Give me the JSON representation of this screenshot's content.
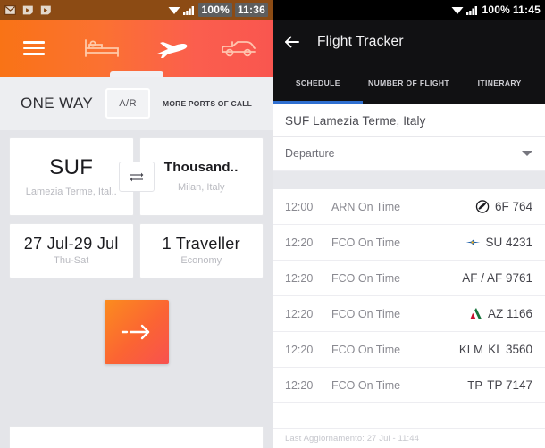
{
  "left_phone": {
    "status_bar": {
      "icons": [
        "gmail-icon",
        "video-badge-icon",
        "video-badge-icon"
      ],
      "battery": "100%",
      "time": "11:36",
      "wifi": "wifi-icon",
      "signal": "signal-icon"
    },
    "app_bar": {
      "menu": "hamburger-icon",
      "tabs": [
        {
          "icon": "hotel-bed-icon",
          "label": "Hotels",
          "active": false
        },
        {
          "icon": "airplane-icon",
          "label": "Flights",
          "active": true
        },
        {
          "icon": "car-icon",
          "label": "Cars",
          "active": false
        }
      ]
    },
    "segment_row": {
      "one_way": "ONE WAY",
      "round_trip": "A/R",
      "more_ports": "MORE PORTS OF CALL"
    },
    "search_form": {
      "origin": {
        "code": "SUF",
        "city": "Lamezia Terme, Ital.."
      },
      "swap": "swap-icon",
      "destination": {
        "code": "Thousand..",
        "city": "Milan, Italy"
      },
      "dates": {
        "range": "27 Jul-29 Jul",
        "days": "Thu-Sat"
      },
      "travellers": {
        "count": "1 Traveller",
        "cabin": "Economy"
      }
    },
    "search_button": {
      "icon": "arrow-right-icon",
      "label": "Search"
    }
  },
  "right_phone": {
    "status_bar": {
      "battery": "100%",
      "time": "11:45",
      "wifi": "wifi-icon",
      "signal": "signal-icon"
    },
    "app_bar": {
      "back": "back-arrow-icon",
      "title": "Flight Tracker"
    },
    "tabs": [
      {
        "label": "SCHEDULE",
        "active": true
      },
      {
        "label": "NUMBER OF FLIGHT",
        "active": false
      },
      {
        "label": "ITINERARY",
        "active": false
      }
    ],
    "filters": {
      "airport": "SUF Lamezia Terme, Italy",
      "direction_label": "Departure",
      "direction_caret": "chevron-down-icon"
    },
    "flights": [
      {
        "time": "12:00",
        "status": "ARN On Time",
        "logo": "6f-logo",
        "code": "6F 764"
      },
      {
        "time": "12:20",
        "status": "FCO On Time",
        "logo": "su-logo",
        "code": "SU 4231"
      },
      {
        "time": "12:20",
        "status": "FCO On Time",
        "logo": "af-logo-text",
        "code": "AF / AF 9761"
      },
      {
        "time": "12:20",
        "status": "FCO On Time",
        "logo": "az-logo",
        "code": "AZ 1166"
      },
      {
        "time": "12:20",
        "status": "FCO On Time",
        "logo": "klm-logo-text",
        "code": "KL 3560"
      },
      {
        "time": "12:20",
        "status": "FCO On Time",
        "logo": "tp-logo-text",
        "code": "TP 7147"
      }
    ],
    "logo_text": {
      "af": "AF /",
      "klm": "KLM",
      "tp": "TP"
    },
    "last_update": "Last Aggiornamento: 27 Jul - 11:44"
  },
  "colors": {
    "left_accent_start": "#f97316",
    "left_accent_end": "#f8514f",
    "left_status_bar": "#8c4b14",
    "right_app_bar": "#111113",
    "right_tab_underline": "#2f6fd0"
  }
}
